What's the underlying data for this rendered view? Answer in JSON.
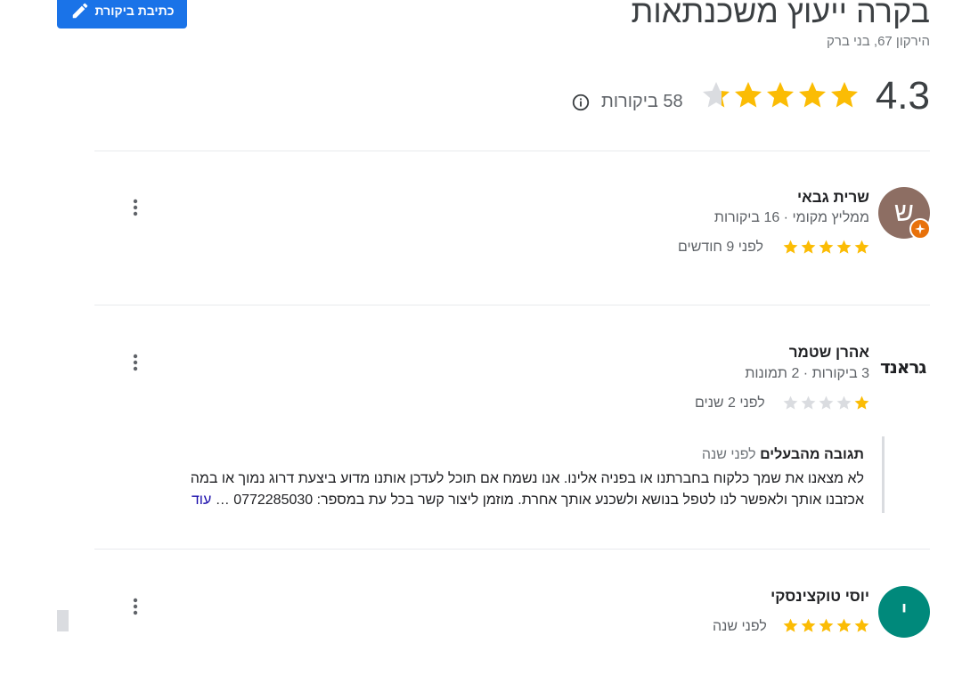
{
  "header": {
    "write_review_label": "כתיבת ביקורת",
    "title": "בקרה ייעוץ משכנתאות",
    "address": "הירקון 67, בני ברק",
    "rating": "4.3",
    "rating_value": 4.3,
    "review_count": "58 ביקורות"
  },
  "reviews": [
    {
      "avatar_letter": "ש",
      "avatar_color": "#8d6e63",
      "name": "שרית גבאי",
      "meta": "ממליץ מקומי · 16 ביקורות",
      "stars": 5,
      "time": "לפני 9 חודשים"
    },
    {
      "logo_text": "גראנד",
      "name": "אהרן שטמר",
      "meta": "3 ביקורות · 2 תמונות",
      "stars": 1,
      "time": "לפני 2 שנים",
      "owner_reply": {
        "title": "תגובה מהבעלים",
        "time": "לפני שנה",
        "text_line1": "לא מצאנו את שמך כלקוח בחברתנו או בפניה אלינו. אנו נשמח אם תוכל לעדכן אותנו מדוע ביצעת דרוג נמוך או במה",
        "text_line2": "אכזבנו אותך ולאפשר לנו לטפל בנושא ולשכנע אותך אחרת. מוזמן ליצור קשר בכל עת במספר: 0772285030",
        "ellipsis": "…",
        "more_label": "עוד"
      }
    },
    {
      "avatar_letter": "י",
      "avatar_color": "#00897b",
      "name": "יוסי טוקצינסקי",
      "stars": 5,
      "time": "לפני שנה"
    }
  ],
  "colors": {
    "star_filled": "#fbbc04",
    "star_empty": "#dadce0",
    "primary": "#1a73e8"
  }
}
